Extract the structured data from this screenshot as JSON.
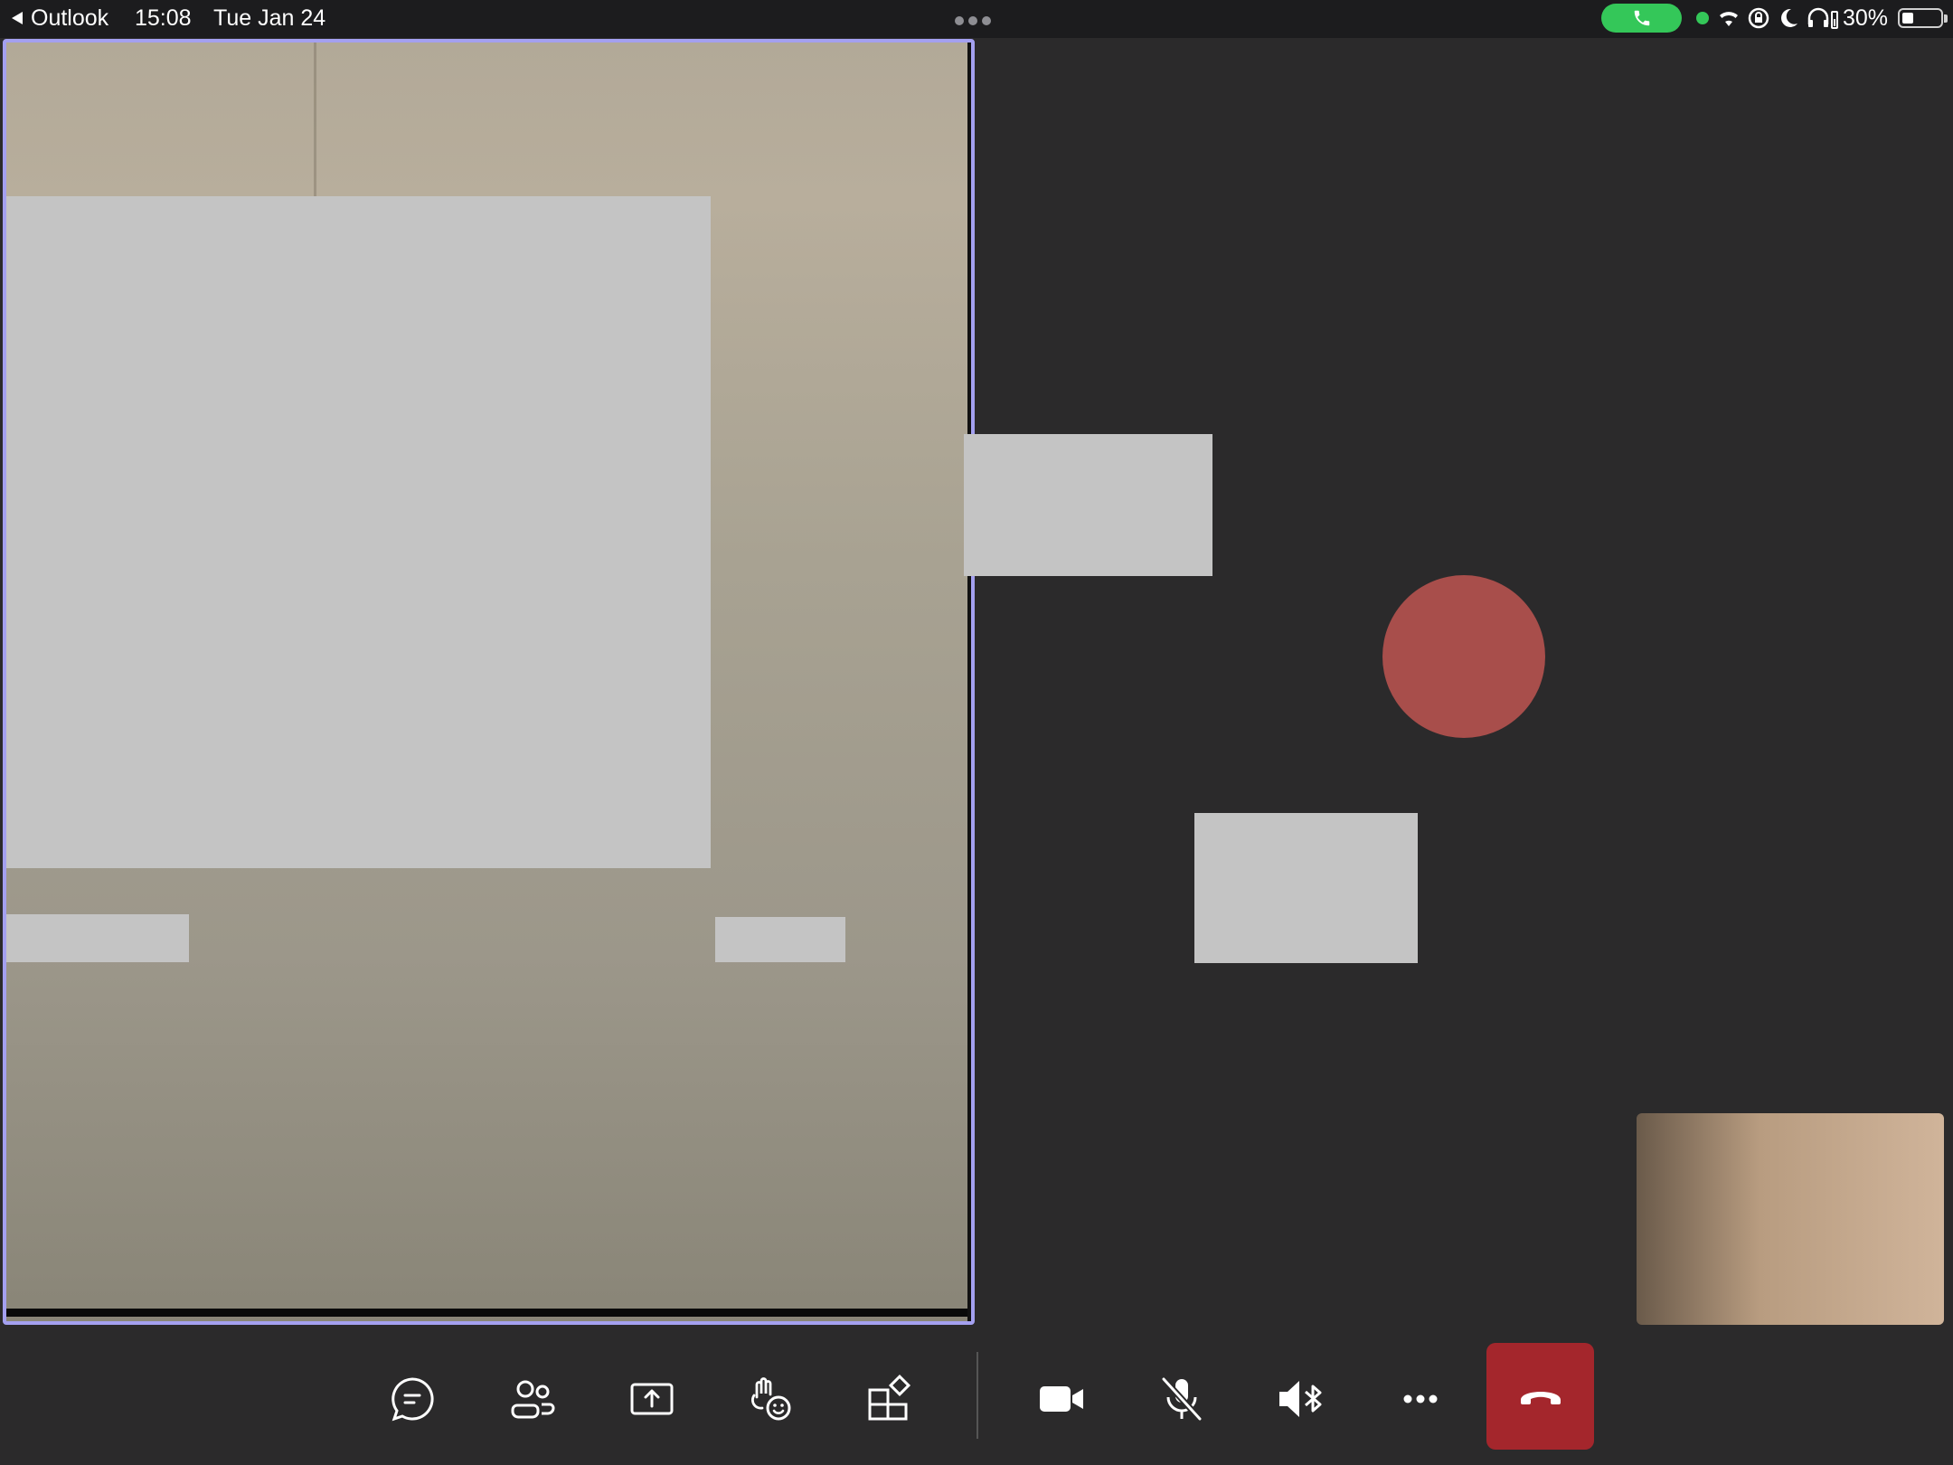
{
  "status_bar": {
    "back_app": "Outlook",
    "time": "15:08",
    "date": "Tue Jan 24",
    "battery_percent": "30%",
    "battery_level": 0.3
  },
  "call": {
    "active_speaker_tile": {
      "highlighted": true
    },
    "participant_avatar_color": "#a84e4b",
    "accent_color": "#a4a0f0",
    "leave_color": "#a4262c"
  },
  "toolbar": {
    "buttons": [
      {
        "icon": "chat-icon"
      },
      {
        "icon": "participants-icon"
      },
      {
        "icon": "share-screen-icon"
      },
      {
        "icon": "reactions-icon"
      },
      {
        "icon": "apps-icon"
      },
      {
        "icon": "camera-icon"
      },
      {
        "icon": "mic-muted-icon"
      },
      {
        "icon": "speaker-bluetooth-icon"
      },
      {
        "icon": "more-icon"
      },
      {
        "icon": "leave-call-icon"
      }
    ]
  }
}
